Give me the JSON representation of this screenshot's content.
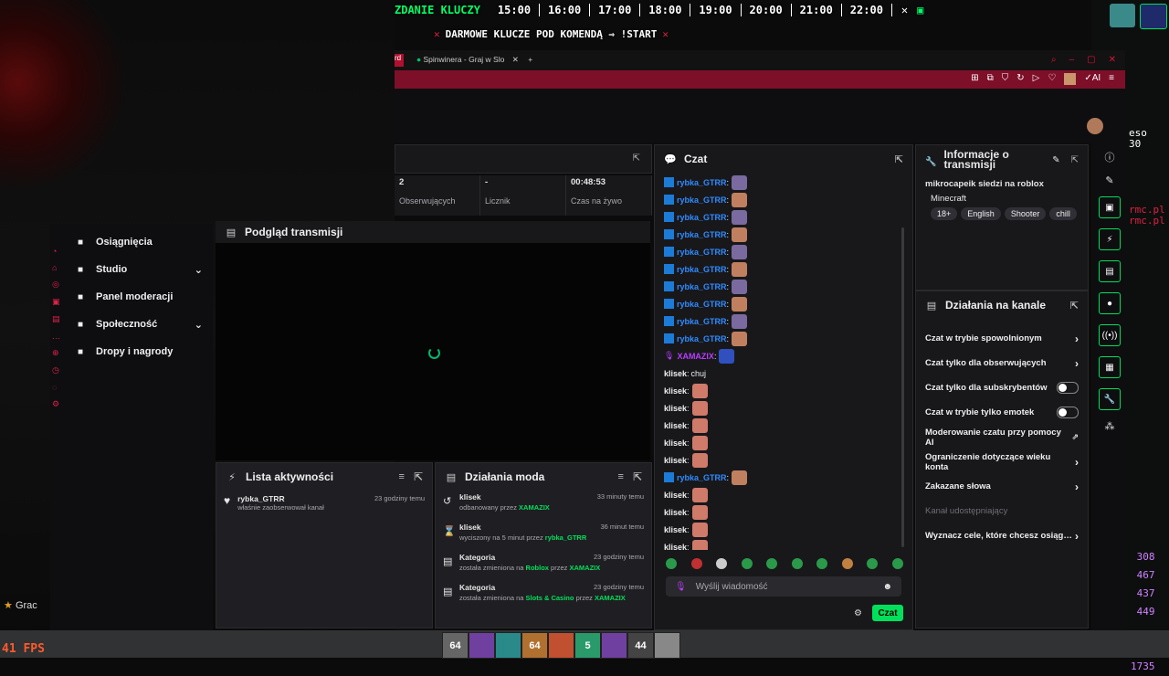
{
  "overlay": {
    "ticker_title": "ZDANIE KLUCZY",
    "times": [
      "15:00",
      "16:00",
      "17:00",
      "18:00",
      "19:00",
      "20:00",
      "21:00",
      "22:00"
    ],
    "banner": "DARMOWE KLUCZE POD KOMENDĄ ⇒ !START",
    "fps": "41 FPS",
    "side_right_text": [
      "eso",
      "30",
      "rmc.pl",
      "rmc.pl"
    ],
    "side_scores": [
      "308",
      "467",
      "437",
      "449",
      "1735"
    ],
    "left_hud": "Grac",
    "hotbar": [
      "64",
      "",
      "",
      "64",
      "",
      "5",
      "",
      "44",
      ""
    ]
  },
  "browser": {
    "tab_partial": "rd",
    "tab_title": "Spinwinera - Graj w Slo",
    "new_tab": "+"
  },
  "leftmenu": {
    "items": [
      {
        "label": "Osiągnięcia",
        "icon": "trophy-icon"
      },
      {
        "label": "Studio",
        "icon": "studio-icon",
        "expand": "⌄"
      },
      {
        "label": "Panel moderacji",
        "icon": "wrench-icon"
      },
      {
        "label": "Społeczność",
        "icon": "community-icon",
        "expand": "⌄"
      },
      {
        "label": "Dropy i nagrody",
        "icon": "gift-icon"
      }
    ]
  },
  "stats": {
    "items": [
      {
        "value": "2",
        "label": "Obserwujących"
      },
      {
        "value": "-",
        "label": "Licznik"
      },
      {
        "value": "00:48:53",
        "label": "Czas na żywo"
      }
    ]
  },
  "preview": {
    "title": "Podgląd transmisji"
  },
  "chat": {
    "title": "Czat",
    "messages": [
      {
        "user": "rybka_GTRR",
        "color": "#2f8bff",
        "text": ""
      },
      {
        "user": "rybka_GTRR",
        "color": "#2f8bff",
        "text": ""
      },
      {
        "user": "rybka_GTRR",
        "color": "#2f8bff",
        "text": ""
      },
      {
        "user": "rybka_GTRR",
        "color": "#2f8bff",
        "text": ""
      },
      {
        "user": "rybka_GTRR",
        "color": "#2f8bff",
        "text": ""
      },
      {
        "user": "rybka_GTRR",
        "color": "#2f8bff",
        "text": ""
      },
      {
        "user": "rybka_GTRR",
        "color": "#2f8bff",
        "text": ""
      },
      {
        "user": "rybka_GTRR",
        "color": "#2f8bff",
        "text": ""
      },
      {
        "user": "rybka_GTRR",
        "color": "#2f8bff",
        "text": ""
      },
      {
        "user": "rybka_GTRR",
        "color": "#2f8bff",
        "text": ""
      },
      {
        "user": "XAMAZIX",
        "color": "#b83cff",
        "text": ""
      },
      {
        "user": "klisek",
        "color": "#efeff1",
        "text": "chuj"
      },
      {
        "user": "klisek",
        "color": "#efeff1",
        "text": ""
      },
      {
        "user": "klisek",
        "color": "#efeff1",
        "text": ""
      },
      {
        "user": "klisek",
        "color": "#efeff1",
        "text": ""
      },
      {
        "user": "klisek",
        "color": "#efeff1",
        "text": ""
      },
      {
        "user": "klisek",
        "color": "#efeff1",
        "text": ""
      },
      {
        "user": "rybka_GTRR",
        "color": "#2f8bff",
        "text": ""
      },
      {
        "user": "klisek",
        "color": "#efeff1",
        "text": ""
      },
      {
        "user": "klisek",
        "color": "#efeff1",
        "text": ""
      },
      {
        "user": "klisek",
        "color": "#efeff1",
        "text": ""
      },
      {
        "user": "klisek",
        "color": "#efeff1",
        "text": ""
      }
    ],
    "input_placeholder": "Wyślij wiadomość",
    "send_label": "Czat"
  },
  "info": {
    "title_line1": "Informacje o",
    "title_line2": "transmisji",
    "stream_title": "mikrocapeik siedzi na roblox",
    "category": "Minecraft",
    "tags": [
      "18+",
      "English",
      "Shooter",
      "chill"
    ]
  },
  "channel_actions": {
    "title": "Działania na kanale",
    "rows": [
      {
        "label": "Czat w trybie spowolnionym",
        "control": "chevron"
      },
      {
        "label": "Czat tylko dla obserwujących",
        "control": "chevron"
      },
      {
        "label": "Czat tylko dla subskrybentów",
        "control": "toggle"
      },
      {
        "label": "Czat w trybie tylko emotek",
        "control": "toggle"
      },
      {
        "label": "Moderowanie czatu przy pomocy AI",
        "control": "external"
      },
      {
        "label": "Ograniczenie dotyczące wieku konta",
        "control": "chevron"
      },
      {
        "label": "Zakazane słowa",
        "control": "chevron"
      },
      {
        "label": "Kanał udostępniający",
        "control": "none",
        "disabled": true
      },
      {
        "label": "Wyznacz cele, które chcesz osiąg…",
        "control": "chevron"
      }
    ]
  },
  "activity": {
    "title": "Lista aktywności",
    "items": [
      {
        "user": "rybka_GTRR",
        "desc": "właśnie zaobserwował kanał",
        "time": "23 godziny temu"
      }
    ]
  },
  "modactions": {
    "title": "Działania moda",
    "items": [
      {
        "icon": "undo-icon",
        "user": "klisek",
        "time": "33 minuty temu",
        "pre": "odbanowany przez ",
        "mid": "XAMAZIX",
        "mid2": "",
        "tail": ""
      },
      {
        "icon": "hourglass-icon",
        "user": "klisek",
        "time": "36 minut temu",
        "pre": "wyciszony na 5 minut przez ",
        "mid": "rybka_GTRR",
        "mid2": "",
        "tail": ""
      },
      {
        "icon": "category-icon",
        "user": "Kategoria",
        "time": "23 godziny temu",
        "pre": "została zmieniona na ",
        "mid": "Roblox",
        "mid2": " przez ",
        "tail": "XAMAZIX"
      },
      {
        "icon": "category-icon",
        "user": "Kategoria",
        "time": "23 godziny temu",
        "pre": "została zmieniona na ",
        "mid": "Slots & Casino",
        "mid2": " przez ",
        "tail": "XAMAZIX"
      }
    ]
  },
  "colors": {
    "accent": "#00e05a",
    "chat_blue": "#2f8bff",
    "mod_purple": "#b83cff",
    "browser_red": "#7e0f29"
  }
}
